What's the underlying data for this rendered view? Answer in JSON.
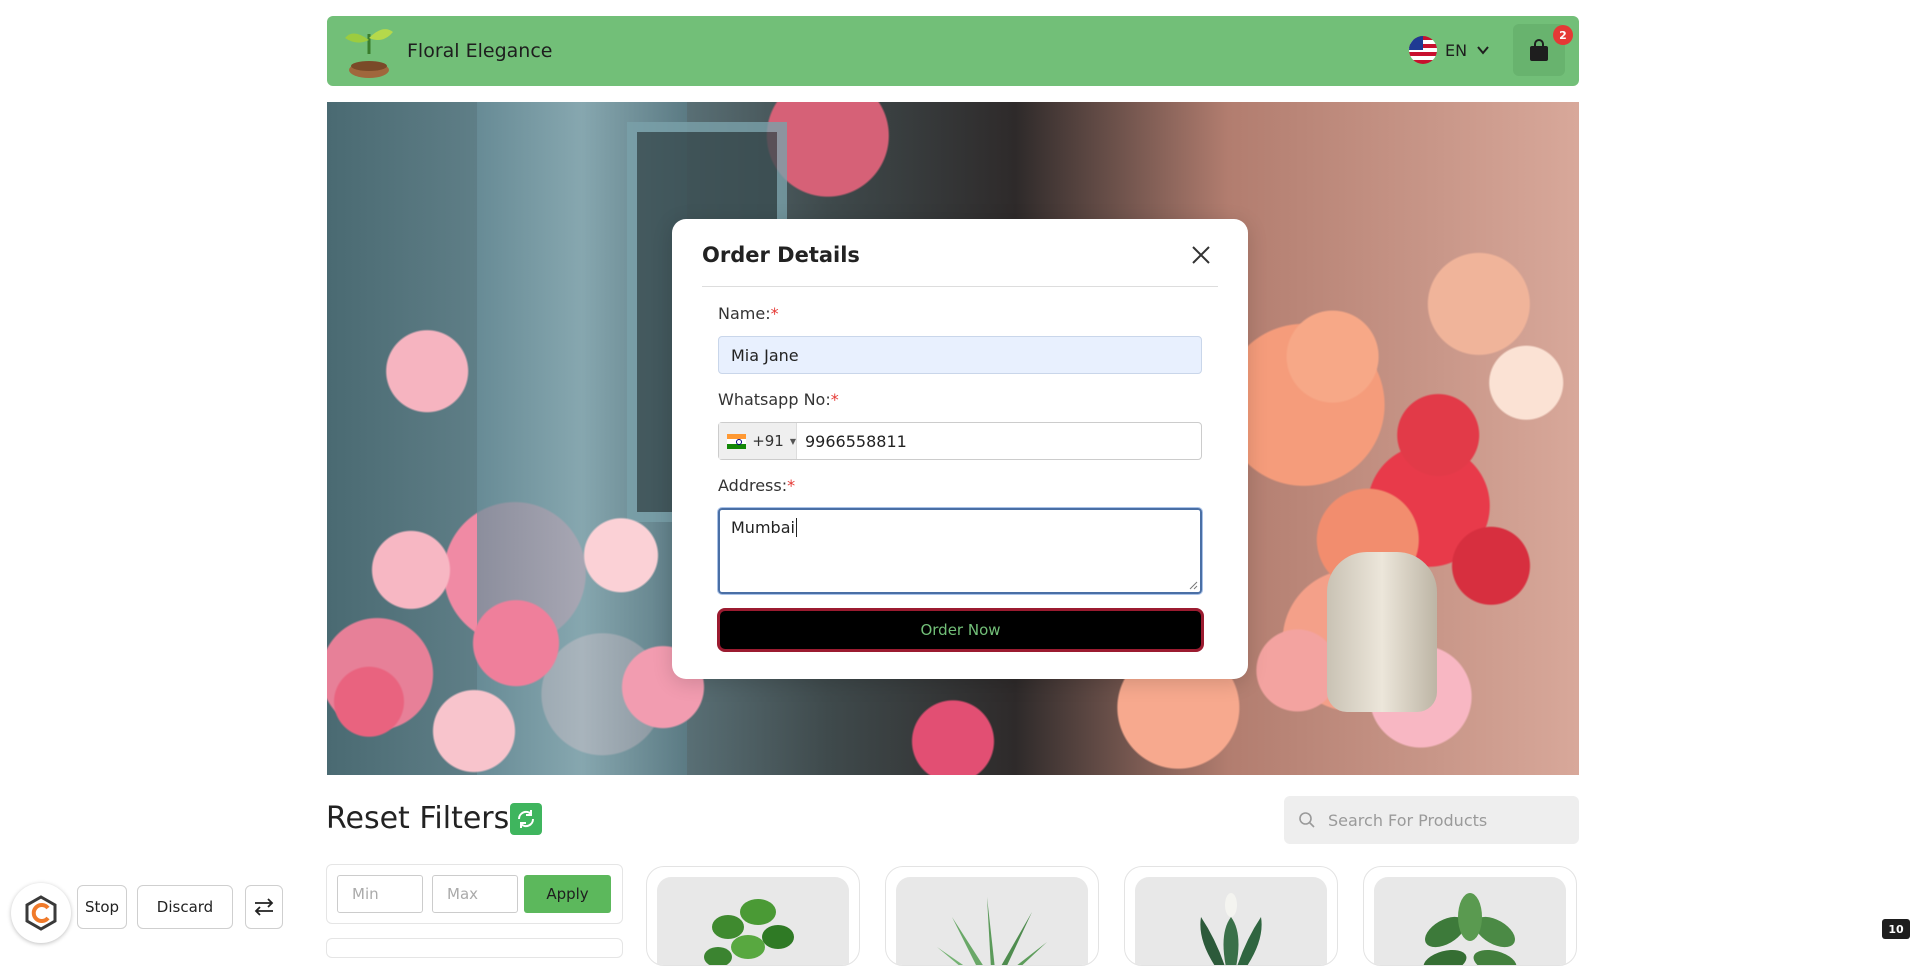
{
  "header": {
    "brand": "Floral Elegance",
    "language": "EN",
    "cart_count": "2",
    "accent": "#72bf78"
  },
  "modal": {
    "title": "Order Details",
    "name_label": "Name:",
    "name_value": "Mia Jane",
    "whatsapp_label": "Whatsapp No:",
    "country_code": "+91",
    "phone_value": "9966558811",
    "address_label": "Address:",
    "address_value": "Mumbai",
    "required_mark": "*",
    "submit_label": "Order Now"
  },
  "filters": {
    "title": "Reset Filters",
    "search_placeholder": "Search For Products",
    "min_placeholder": "Min",
    "max_placeholder": "Max",
    "apply_label": "Apply"
  },
  "products": [
    {
      "icon": "pothos-plant"
    },
    {
      "icon": "aloe-plant"
    },
    {
      "icon": "peace-lily-plant"
    },
    {
      "icon": "calathea-plant"
    }
  ],
  "toolbar": {
    "stop_label": "Stop",
    "discard_label": "Discard"
  },
  "page_counter": "10"
}
